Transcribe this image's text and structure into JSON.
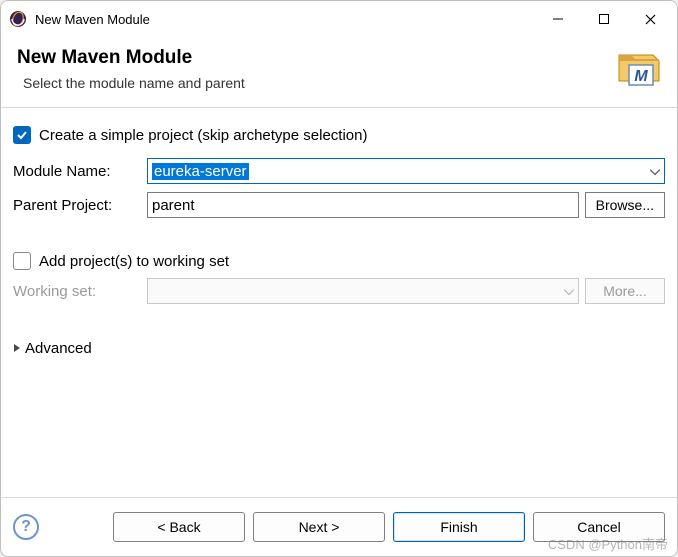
{
  "window": {
    "title": "New Maven Module"
  },
  "header": {
    "heading": "New Maven Module",
    "subtitle": "Select the module name and parent"
  },
  "form": {
    "simple_project": {
      "label": "Create a simple project (skip archetype selection)",
      "checked": true
    },
    "module_name": {
      "label": "Module Name:",
      "value": "eureka-server"
    },
    "parent_project": {
      "label": "Parent Project:",
      "value": "parent",
      "browse_label": "Browse..."
    },
    "working_set": {
      "add_label": "Add project(s) to working set",
      "add_checked": false,
      "label": "Working set:",
      "value": "",
      "more_label": "More..."
    },
    "advanced_label": "Advanced"
  },
  "footer": {
    "help_symbol": "?",
    "back": "< Back",
    "next": "Next >",
    "finish": "Finish",
    "cancel": "Cancel"
  },
  "watermark": "CSDN @Python南帝"
}
